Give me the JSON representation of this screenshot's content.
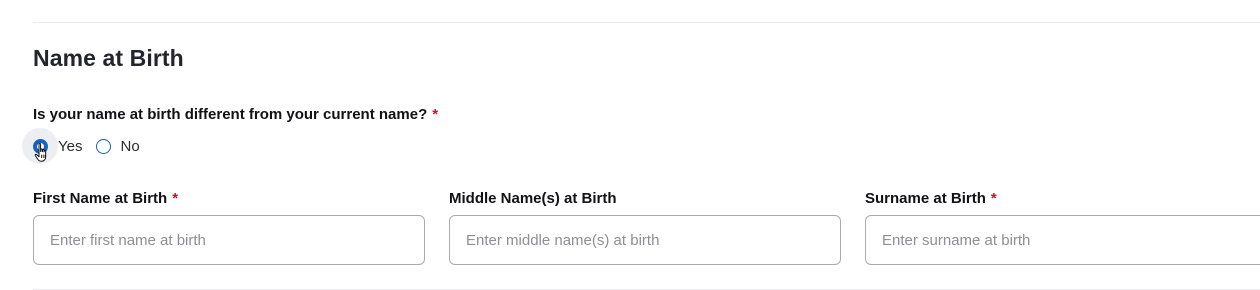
{
  "section": {
    "title": "Name at Birth"
  },
  "question": {
    "text": "Is your name at birth different from your current name?",
    "required_mark": "*",
    "options": [
      {
        "label": "Yes",
        "selected": true
      },
      {
        "label": "No",
        "selected": false
      }
    ]
  },
  "fields": {
    "first": {
      "label": "First Name at Birth",
      "required_mark": "*",
      "value": "",
      "placeholder": "Enter first name at birth"
    },
    "middle": {
      "label": "Middle Name(s) at Birth",
      "value": "",
      "placeholder": "Enter middle name(s) at birth"
    },
    "surname": {
      "label": "Surname at Birth",
      "required_mark": "*",
      "value": "",
      "placeholder": "Enter surname at birth"
    }
  },
  "colors": {
    "accent": "#1565c0",
    "required": "#c8102e",
    "border": "#a9a9b1"
  },
  "icons": {
    "cursor": "hand-pointer-icon"
  }
}
